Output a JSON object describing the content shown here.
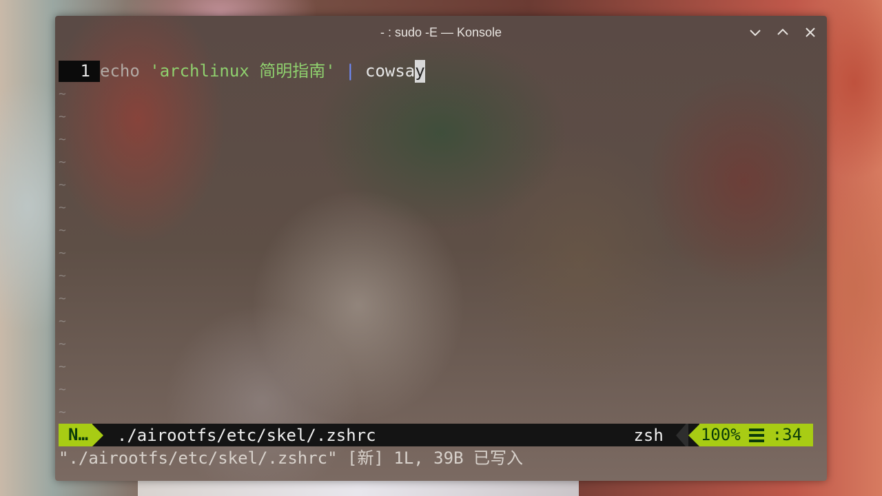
{
  "window": {
    "title": "- : sudo -E — Konsole"
  },
  "editor": {
    "lines": [
      {
        "number": "1",
        "keyword": "echo",
        "string": "'archlinux 简明指南'",
        "pipe": "|",
        "command_before_cursor": "cowsa",
        "cursor_char": "y"
      }
    ],
    "empty_line_marker": "~"
  },
  "statusline": {
    "mode": "N…",
    "file_path": "./airootfs/etc/skel/.zshrc",
    "filetype": "zsh",
    "percent": "100%",
    "column": ":34",
    "menu_icon": "hamburger-icon"
  },
  "cmdline": {
    "message": "\"./airootfs/etc/skel/.zshrc\" [新] 1L, 39B 已写入"
  },
  "colors": {
    "mode_bg": "#a8cc14",
    "string": "#8fd06e",
    "pipe": "#6f8cff"
  }
}
